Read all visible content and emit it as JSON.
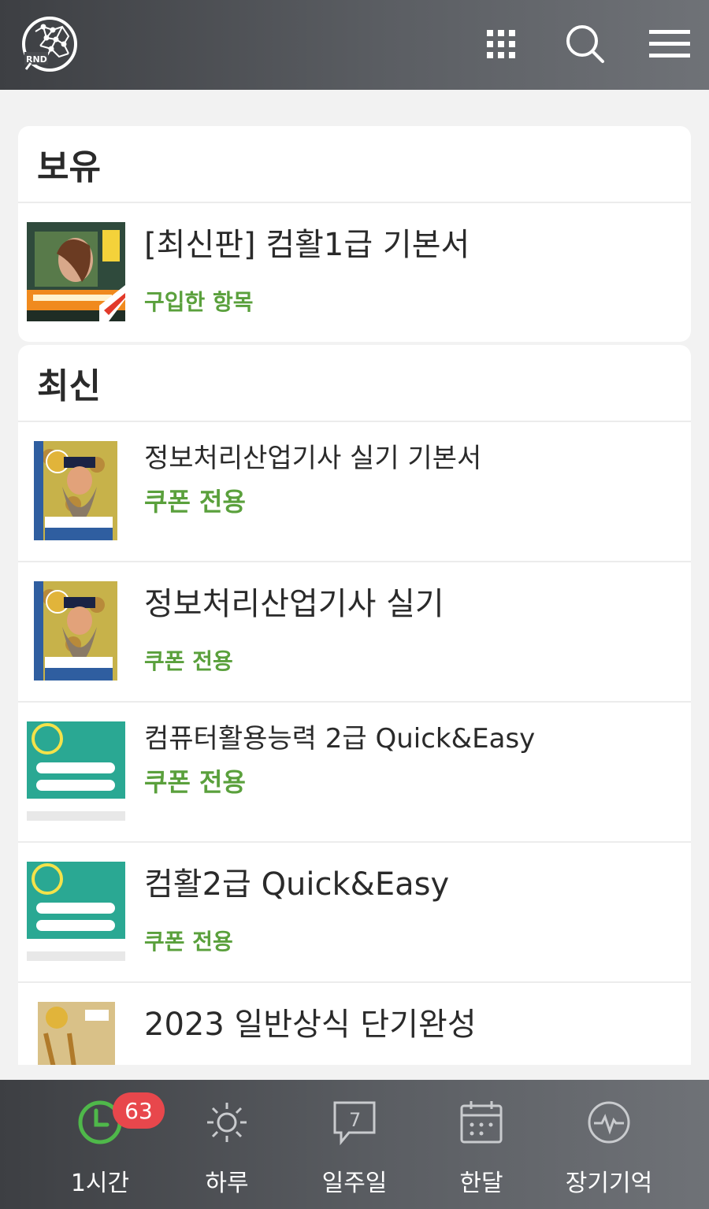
{
  "header": {
    "logo_text": "RND",
    "icons": [
      "apps-grid-icon",
      "search-icon",
      "hamburger-menu-icon"
    ]
  },
  "owned": {
    "title": "보유",
    "items": [
      {
        "title": "[최신판] 컴활1급 기본서",
        "sub": "구입한 항목",
        "cover": "dark"
      }
    ]
  },
  "latest": {
    "title": "최신",
    "items": [
      {
        "title": "정보처리산업기사 실기 기본서",
        "sub": "쿠폰 전용",
        "cover": "blue"
      },
      {
        "title": "정보처리산업기사 실기",
        "sub": "쿠폰 전용",
        "cover": "blue"
      },
      {
        "title": "컴퓨터활용능력 2급 Quick&Easy",
        "sub": "쿠폰 전용",
        "cover": "green"
      },
      {
        "title": "컴활2급 Quick&Easy",
        "sub": "쿠폰 전용",
        "cover": "green"
      },
      {
        "title": "2023 일반상식 단기완성",
        "sub": "",
        "cover": "gold"
      }
    ]
  },
  "bottom_nav": [
    {
      "label": "1시간",
      "icon": "clock-icon",
      "badge": "63",
      "active": true
    },
    {
      "label": "하루",
      "icon": "sun-icon"
    },
    {
      "label": "일주일",
      "icon": "speech-bubble-7-icon",
      "icon_text": "7"
    },
    {
      "label": "한달",
      "icon": "calendar-icon"
    },
    {
      "label": "장기기억",
      "icon": "pulse-circle-icon"
    }
  ],
  "colors": {
    "accent_green": "#5aa03c",
    "badge_red": "#e8474c",
    "bar_dark": "#3d3f43"
  }
}
